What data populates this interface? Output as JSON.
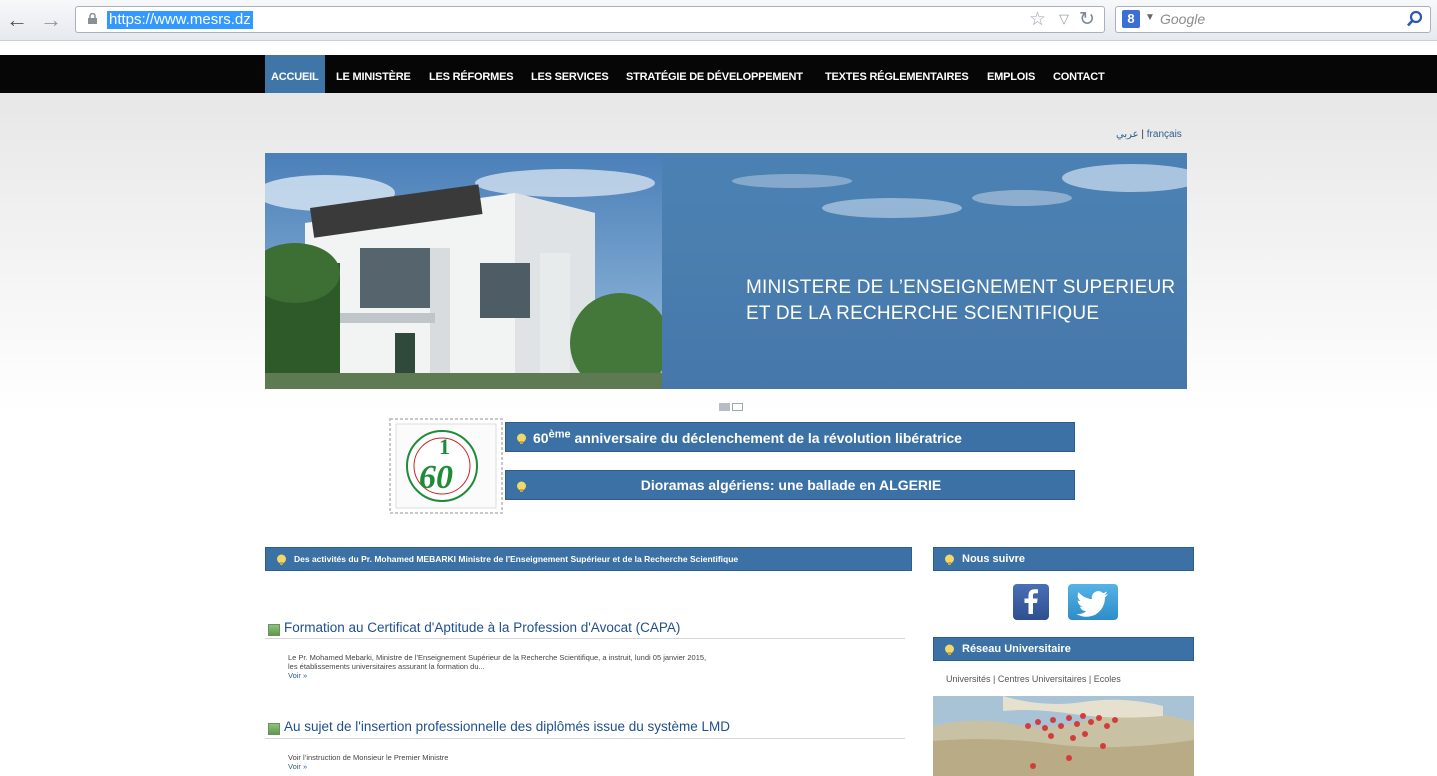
{
  "browser": {
    "url": "https://www.mesrs.dz",
    "search_placeholder": "Google",
    "search_engine_badge": "8"
  },
  "nav": {
    "items": [
      "ACCUEIL",
      "LE MINISTÈRE",
      "LES RÉFORMES",
      "LES SERVICES",
      "STRATÉGIE DE DÉVELOPPEMENT",
      "TEXTES RÉGLEMENTAIRES",
      "EMPLOIS",
      "CONTACT"
    ],
    "active_index": 0
  },
  "languages": {
    "arabic": "عربي",
    "separator": "|",
    "french": "français"
  },
  "banner": {
    "line1": "MINISTERE DE L’ENSEIGNEMENT SUPERIEUR",
    "line2": "ET DE LA RECHERCHE SCIENTIFIQUE",
    "slides": 2,
    "current_slide": 1
  },
  "stamp": {
    "number": "60",
    "top_number": "1"
  },
  "promos": {
    "first_prefix": "60",
    "first_sup": "ème",
    "first_rest": " anniversaire du déclenchement de la révolution libératrice",
    "second": "Dioramas algériens: une ballade en ALGERIE"
  },
  "sections": {
    "activities": "Des activités du Pr. Mohamed MEBARKI Ministre de l'Enseignement Supérieur et de la Recherche Scientifique",
    "follow": "Nous suivre",
    "network": "Réseau Universitaire",
    "network_links": "Universités | Centres Universitaires | Ecoles"
  },
  "articles": [
    {
      "title": "Formation au Certificat d'Aptitude à la Profession d'Avocat (CAPA)",
      "body_line1": "Le Pr. Mohamed Mebarki, Ministre de l’Enseignement Supérieur de la Recherche Scientifique, a instruit, lundi 05 janvier 2015,",
      "body_line2": "les établissements universitaires assurant la formation du...",
      "more": "Voir »"
    },
    {
      "title": "Au sujet de l'insertion professionnelle des diplômés issue du système LMD",
      "body_line1": "Voir l’instruction de Monsieur le Premier Ministre",
      "more": "Voir »"
    }
  ],
  "colors": {
    "nav_bg": "#060606",
    "accent_blue": "#3b71a4",
    "active_tab": "#3f76a7",
    "banner_blue": "#4a80b3"
  }
}
